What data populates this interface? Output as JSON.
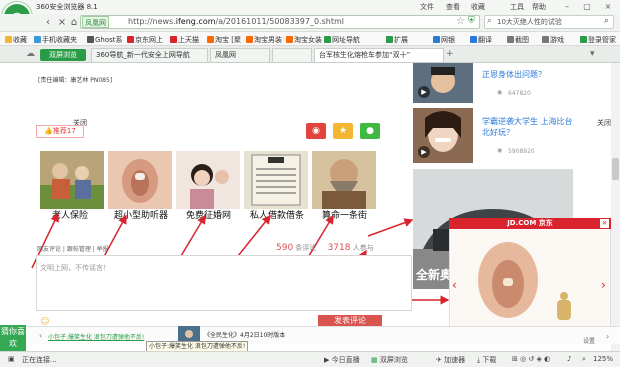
{
  "window": {
    "title": "360安全浏览器 8.1",
    "menu": [
      "文件",
      "查看",
      "收藏",
      "工具",
      "帮助"
    ],
    "logo_letter": "e"
  },
  "address": {
    "site_tag": "凤凰网",
    "url_prefix": "http://news.",
    "url_domain": "ifeng.com",
    "url_rest": "/a/20161011/50083397_0.shtml",
    "search_text": "10大灭绝人性的试验"
  },
  "bookmarks": [
    "收藏",
    "手机收藏夹",
    "Ghost系",
    "京东网上",
    "上天猫",
    "淘宝 [聚",
    "淘宝男装",
    "淘宝女装",
    "网址导航"
  ],
  "bookmarks_right": [
    "扩展",
    "网银",
    "翻译",
    "截图",
    "游戏",
    "登录管家"
  ],
  "tabs": {
    "dual_view": "双屏浏览",
    "items": [
      "360导航_新一代安全上网导航",
      "凤凰网",
      "",
      "台军核生化熔枪车参加“双十”"
    ]
  },
  "article": {
    "editor": "[责任编辑：康艺林 PN085]",
    "close_left": "关闭",
    "close_right": "关闭",
    "recommend": "推荐17",
    "captions": [
      "老人保险",
      "超小型助听器",
      "免费征婚网",
      "私人借款借条",
      "算命一条街"
    ],
    "links": "网友评论 | 跟帖管理 | 举报",
    "comment_count": "590",
    "comment_label": "条评论",
    "participant_count": "3718",
    "participant_label": "人参与",
    "comment_placeholder": "文明上网，不传谣言！",
    "submit": "发表评论"
  },
  "sidebar": {
    "items": [
      {
        "text": "正恩身体出问题？",
        "meta": "647820"
      },
      {
        "text": "学霸逆袭大学生 上海比台北好玩？",
        "meta": "5908920"
      }
    ],
    "promo": "全新奥"
  },
  "ad": {
    "header": "JD.COM 京东",
    "close": "×"
  },
  "bottom": {
    "badge": "猜你喜欢",
    "news_text": "小包子:爆笑生化 浪包刀遭弹他不反!",
    "news_right": "《全民生化》4月2日10时版本",
    "tooltip": "小包子:爆笑生化 浪包刀遭弹他不反!",
    "settings": "设置"
  },
  "status": {
    "left": "正在连接...",
    "items": [
      "今日直播",
      "双屏浏览",
      "加速器",
      "下载"
    ],
    "zoom": "125%"
  }
}
